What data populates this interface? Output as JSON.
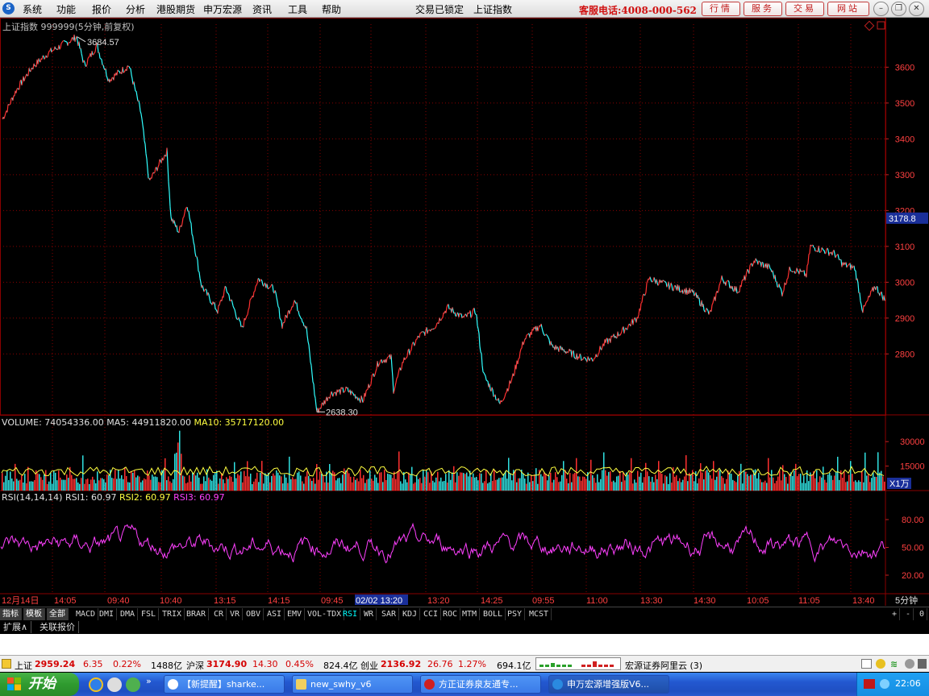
{
  "menu": {
    "items": [
      "系统",
      "功能",
      "报价",
      "分析",
      "港股期货",
      "申万宏源",
      "资讯",
      "工具",
      "帮助"
    ],
    "status_lock": "交易已锁定",
    "current_index": "上证指数",
    "hotline": "客服电话:4008-000-562",
    "buttons": [
      "行情",
      "服务",
      "交易",
      "网站"
    ]
  },
  "chart": {
    "pane_title": "上证指数 999999(5分钟,前复权)",
    "high_label": "3684.57",
    "low_label": "2638.30",
    "current_price": "3178.8",
    "price_axis": [
      "3600",
      "3500",
      "3400",
      "3300",
      "3200",
      "3100",
      "3000",
      "2900",
      "2800"
    ],
    "volume_header": {
      "vol": "VOLUME: 74054336.00",
      "ma5": "MA5: 44911820.00",
      "ma10": "MA10: 35717120.00"
    },
    "volume_axis": [
      "30000",
      "15000"
    ],
    "volume_unit": "X1万",
    "rsi_header": {
      "name": "RSI(14,14,14)",
      "rsi1": "RSI1: 60.97",
      "rsi2": "RSI2: 60.97",
      "rsi3": "RSI3: 60.97"
    },
    "rsi_axis": [
      "80.00",
      "50.00",
      "20.00"
    ],
    "time_axis": [
      "12月14日",
      "14:05",
      "09:40",
      "10:40",
      "13:15",
      "14:15",
      "09:45",
      "02/02 13:20",
      "13:20",
      "14:25",
      "09:55",
      "11:00",
      "13:30",
      "14:30",
      "10:05",
      "11:05",
      "13:40"
    ],
    "period": "5分钟",
    "colors": {
      "up": "#ff3030",
      "down": "#30ffff",
      "grid": "#8a0000",
      "rsi": "#ff40ff",
      "vol_ma5": "#ffff40"
    }
  },
  "chart_data": {
    "type": "line",
    "title": "上证指数 999999(5分钟,前复权)",
    "x": [
      "12月14日",
      "14:05",
      "09:40",
      "10:40",
      "13:15",
      "14:15",
      "09:45",
      "02/02 13:20",
      "13:20",
      "14:25",
      "09:55",
      "11:00",
      "13:30",
      "14:30",
      "10:05",
      "11:05",
      "13:40"
    ],
    "series": [
      {
        "name": "上证指数",
        "values": [
          3500,
          3684.57,
          3600,
          3270,
          2990,
          2950,
          2638.3,
          2770,
          2930,
          2660,
          2840,
          2900,
          3000,
          2920,
          3060,
          3100,
          2960
        ]
      }
    ],
    "ylim": [
      2630,
      3720
    ],
    "annotations": [
      "3684.57",
      "2638.30",
      "3178.8"
    ]
  },
  "indicators": {
    "tabs": [
      "指标",
      "模板",
      "全部",
      "MACD",
      "DMI",
      "DMA",
      "FSL",
      "TRIX",
      "BRAR",
      "CR",
      "VR",
      "OBV",
      "ASI",
      "EMV",
      "VOL-TDX",
      "RSI",
      "WR",
      "SAR",
      "KDJ",
      "CCI",
      "ROC",
      "MTM",
      "BOLL",
      "PSY",
      "MCST"
    ],
    "active": "RSI",
    "controls": [
      "+",
      "-",
      "0"
    ]
  },
  "extension": {
    "tabs": [
      "扩展∧",
      "关联报价"
    ]
  },
  "status": {
    "sh_label": "上证",
    "sh_price": "2959.24",
    "sh_change": "6.35",
    "sh_pct": "0.22%",
    "sh_amount": "1488亿",
    "hs_label": "沪深",
    "hs_price": "3174.90",
    "hs_change": "14.30",
    "hs_pct": "0.45%",
    "hs_amount": "824.4亿",
    "cy_label": "创业",
    "cy_price": "2136.92",
    "cy_change": "26.76",
    "cy_pct": "1.27%",
    "cy_amount": "694.1亿",
    "broker": "宏源证券阿里云 (3)"
  },
  "taskbar": {
    "start": "开始",
    "items": [
      "【新提醒】sharke...",
      "new_swhy_v6",
      "方正证券泉友通专...",
      "申万宏源增强版V6..."
    ],
    "clock": "22:06"
  }
}
